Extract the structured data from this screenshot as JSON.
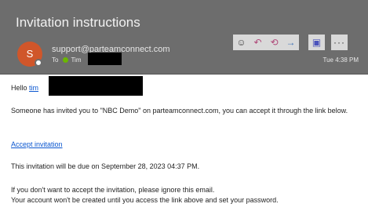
{
  "header": {
    "subject": "Invitation instructions",
    "avatar_initial": "S",
    "sender": "support@parteamconnect.com",
    "to_label": "To",
    "to_name": "Tim",
    "time": "Tue 4:38 PM",
    "background": "#6d6d6d",
    "avatar_color": "#d0562a"
  },
  "toolbar": {
    "emoji_icon": "☺",
    "reply_icon": "↶",
    "reply_all_icon": "⟲",
    "forward_icon": "→",
    "teams_icon": "▣",
    "more_icon": "···"
  },
  "body": {
    "greeting": "Hello",
    "greeting_name": "tim",
    "paragraph1": "Someone has invited you to \"NBC Demo\" on parteamconnect.com, you can accept it through the link below.",
    "accept_link": "Accept invitation",
    "due_text": "This invitation will be due on September 28, 2023 04:37 PM.",
    "ignore_line": "If you don't want to accept the invitation, please ignore this email.",
    "account_line": "Your account won't be created until you access the link above and set your password.",
    "link_color": "#0b57d0"
  }
}
